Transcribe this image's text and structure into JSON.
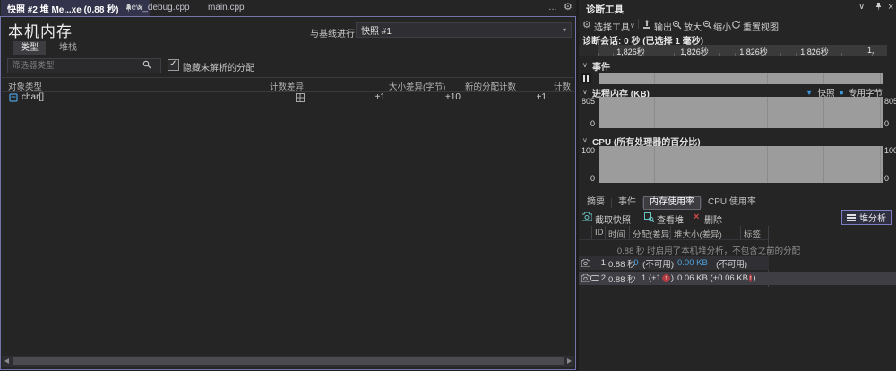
{
  "icons": {
    "gear": "⚙",
    "ellipsis": "…",
    "chevron_down": "∨",
    "close": "×",
    "dropdown_arrow": "▾",
    "check": "✓",
    "section_chevron": "∨",
    "snapshot_marker": "▼",
    "dot": "●",
    "up_arrow": "↑",
    "delete_x": "×"
  },
  "editor_tabs": {
    "active": "快照 #2 堆 Me...xe (0.88 秒)",
    "tab2": "new_debug.cpp",
    "tab3": "main.cpp"
  },
  "memory_view": {
    "title": "本机内存",
    "baseline_label": "与基线进行比较:",
    "baseline_value": "快照 #1",
    "tab_types": "类型",
    "tab_stacks": "堆栈",
    "filter_placeholder": "筛选器类型",
    "hide_unresolved": "隐藏未解析的分配",
    "columns": {
      "type": "对象类型",
      "count_diff": "计数差异",
      "size_diff": "大小差异(字节)",
      "new_alloc": "新的分配计数",
      "count": "计数"
    },
    "rows": [
      {
        "type": "char[]",
        "count_diff": "+1",
        "size_diff": "+10",
        "new_alloc": "+1",
        "count": ""
      }
    ]
  },
  "diag": {
    "title": "诊断工具",
    "toolbar": {
      "select_tool": "选择工具",
      "output": "输出",
      "zoom_in": "放大",
      "zoom_out": "缩小",
      "reset_view": "重置视图"
    },
    "session": "诊断会话: 0 秒 (已选择 1 毫秒)",
    "ruler": [
      "1,826秒",
      "1,826秒",
      "1,826秒",
      "1,826秒",
      "1,"
    ],
    "events_title": "事件",
    "memory_title": "进程内存 (KB)",
    "legend": {
      "snapshot": "快照",
      "private_bytes": "专用字节"
    },
    "memory_axis": {
      "max": "805",
      "min": "0"
    },
    "cpu_title": "CPU (所有处理器的百分比)",
    "cpu_axis": {
      "max": "100",
      "min": "0"
    },
    "tabs": {
      "summary": "摘要",
      "events": "事件",
      "memory": "内存使用率",
      "cpu": "CPU 使用率"
    },
    "actions": {
      "take_snapshot": "截取快照",
      "view_heap": "查看堆",
      "delete": "删除",
      "heap_analysis": "堆分析"
    },
    "table": {
      "columns": {
        "id": "ID",
        "time": "时间",
        "alloc": "分配(差异)",
        "heap": "堆大小(差异)",
        "tag": "标签"
      },
      "notice": "0.88 秒 时启用了本机堆分析，不包含之前的分配",
      "row1": {
        "id": "1",
        "time": "0.88 秒",
        "alloc_value": "0",
        "alloc_note": "(不可用)",
        "heap_value": "0.00 KB",
        "heap_note": "(不可用)"
      },
      "row2": {
        "id": "2",
        "time": "0.88 秒",
        "alloc_pre": "1 (+1",
        "alloc_post": ")",
        "heap_pre": "0.06 KB (+0.06 KB",
        "heap_post": ")"
      }
    }
  },
  "colors": {
    "accent_purple": "#7474aa",
    "accent_blue": "#3a96dd",
    "link_blue": "#4da3e0",
    "chart_gray": "#9c9c9c",
    "delete_red": "#d14949",
    "arrow_red": "#b23a42"
  }
}
